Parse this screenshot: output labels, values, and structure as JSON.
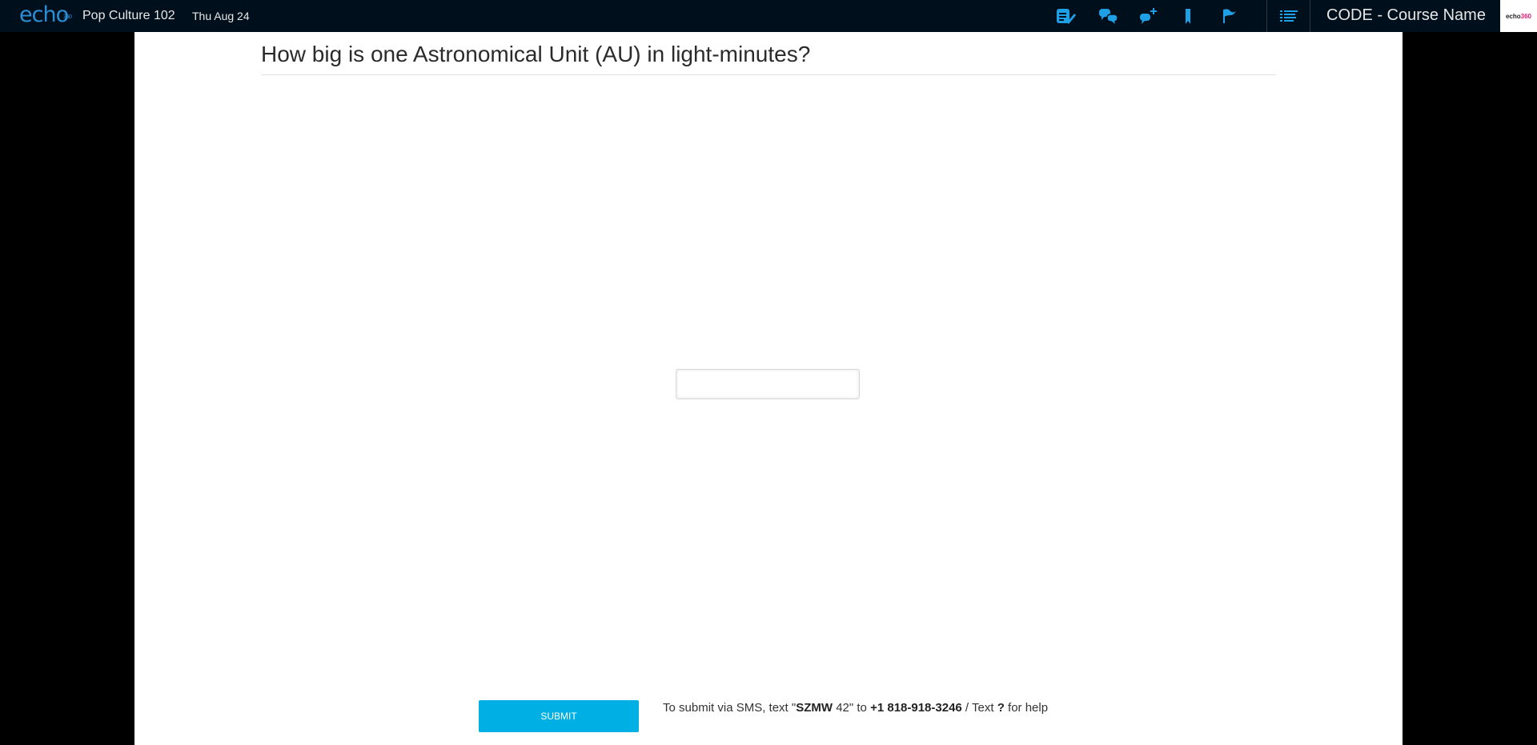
{
  "header": {
    "logo": "echo",
    "logo_superscript": "360",
    "course": "Pop Culture 102",
    "date": "Thu Aug 24",
    "icons": [
      "notes-icon",
      "discussion-icon",
      "new-question-icon",
      "bookmark-icon",
      "flag-icon",
      "list-icon"
    ],
    "course_name": "CODE - Course Name",
    "brand_logo_main": "echo",
    "brand_logo_accent": "360"
  },
  "question": {
    "title": "How big is one Astronomical Unit (AU) in light-minutes?",
    "answer_value": "",
    "answer_placeholder": ""
  },
  "footer": {
    "submit_label": "SUBMIT",
    "sms_prefix": "To submit via SMS, text \"",
    "sms_code": "SZMW",
    "sms_code_suffix": " 42\" to ",
    "sms_number": "+1 818-918-3246",
    "sms_mid": " / Text ",
    "sms_help_char": "?",
    "sms_suffix": " for help"
  },
  "colors": {
    "header_bg": "#000f1c",
    "accent": "#00b0e4",
    "icon_blue": "#1ea0e6",
    "brand_pink": "#e0207a"
  }
}
